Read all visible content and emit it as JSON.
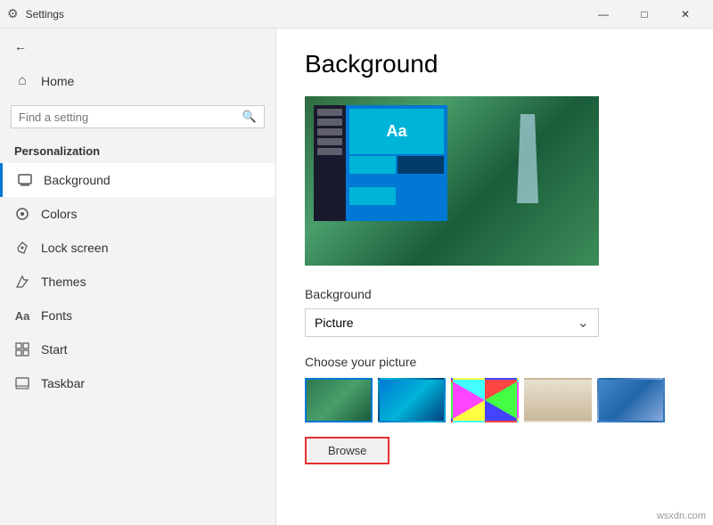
{
  "titleBar": {
    "title": "Settings",
    "minimize": "—",
    "maximize": "□",
    "close": "✕"
  },
  "sidebar": {
    "back_label": "←",
    "home_label": "Home",
    "search_placeholder": "Find a setting",
    "section_title": "Personalization",
    "nav_items": [
      {
        "id": "background",
        "label": "Background",
        "icon": "🖼",
        "active": true
      },
      {
        "id": "colors",
        "label": "Colors",
        "icon": "🎨",
        "active": false
      },
      {
        "id": "lock-screen",
        "label": "Lock screen",
        "icon": "✏️",
        "active": false
      },
      {
        "id": "themes",
        "label": "Themes",
        "icon": "🖌",
        "active": false
      },
      {
        "id": "fonts",
        "label": "Fonts",
        "icon": "Aa",
        "active": false
      },
      {
        "id": "start",
        "label": "Start",
        "icon": "▦",
        "active": false
      },
      {
        "id": "taskbar",
        "label": "Taskbar",
        "icon": "▬",
        "active": false
      }
    ]
  },
  "content": {
    "title": "Background",
    "background_label": "Background",
    "dropdown_value": "Picture",
    "dropdown_arrow": "⌄",
    "choose_label": "Choose your picture",
    "browse_label": "Browse",
    "thumbnails": [
      {
        "id": "thumb-1",
        "class": "thumb-1"
      },
      {
        "id": "thumb-2",
        "class": "thumb-2"
      },
      {
        "id": "thumb-3",
        "class": "thumb-3"
      },
      {
        "id": "thumb-4",
        "class": "thumb-4"
      },
      {
        "id": "thumb-5",
        "class": "thumb-5"
      }
    ]
  },
  "watermark": "wsxdn.com",
  "icons": {
    "home": "⌂",
    "search": "🔍",
    "back_arrow": "←",
    "background_icon": "□",
    "colors_icon": "◎",
    "lock_icon": "✏",
    "themes_icon": "🖌",
    "fonts_icon": "A",
    "start_icon": "⊞",
    "taskbar_icon": "▭"
  }
}
